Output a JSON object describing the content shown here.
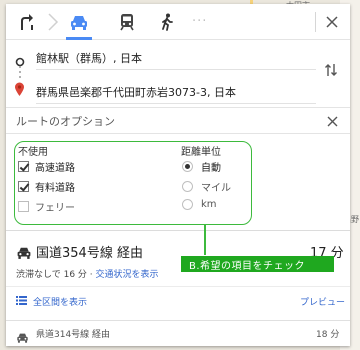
{
  "map": {
    "labels": [
      "太田市",
      "出野"
    ]
  },
  "header": {
    "modes": [
      {
        "icon": "directions-icon",
        "active": false
      },
      {
        "icon": "car-icon",
        "active": true
      },
      {
        "icon": "train-icon",
        "active": false
      },
      {
        "icon": "walk-icon",
        "active": false
      }
    ],
    "more": "···"
  },
  "waypoints": {
    "origin": "館林駅（群馬）, 日本",
    "destination": "群馬県邑楽郡千代田町赤岩3073-3, 日本"
  },
  "options": {
    "title": "ルートのオプション",
    "avoid": {
      "title": "不使用",
      "items": [
        {
          "label": "高速道路",
          "checked": true
        },
        {
          "label": "有料道路",
          "checked": true
        },
        {
          "label": "フェリー",
          "checked": false
        }
      ]
    },
    "units": {
      "title": "距離単位",
      "items": [
        {
          "label": "自動",
          "selected": true
        },
        {
          "label": "マイル",
          "selected": false
        },
        {
          "label": "km",
          "selected": false
        }
      ]
    }
  },
  "routes": [
    {
      "title": "国道354号線 経由",
      "time": "17 分",
      "traffic_prefix": "渋滞なしで 16 分 · ",
      "traffic_link": "交通状況を表示",
      "list_link": "全区間を表示",
      "preview_link": "プレビュー"
    },
    {
      "title": "県道314号線 経由",
      "time": "18 分"
    }
  ],
  "annotation": "B.希望の項目をチェック",
  "colors": {
    "accent": "#4a8af4",
    "annotation_green": "#1fa81f",
    "link": "#3366cc",
    "destination_pin": "#db4437"
  }
}
